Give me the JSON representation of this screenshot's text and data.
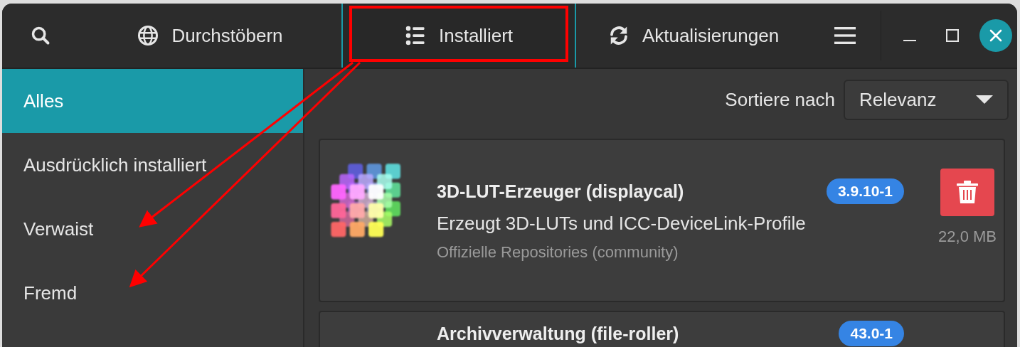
{
  "header": {
    "tabs": [
      {
        "label": "Durchstöbern",
        "selected": false
      },
      {
        "label": "Installiert",
        "selected": true
      },
      {
        "label": "Aktualisierungen",
        "selected": false
      }
    ]
  },
  "sidebar": {
    "items": [
      {
        "label": "Alles",
        "selected": true
      },
      {
        "label": "Ausdrücklich installiert",
        "selected": false
      },
      {
        "label": "Verwaist",
        "selected": false
      },
      {
        "label": "Fremd",
        "selected": false
      }
    ]
  },
  "sort": {
    "label": "Sortiere nach",
    "value": "Relevanz"
  },
  "packages": [
    {
      "name": "3D-LUT-Erzeuger (displaycal)",
      "version": "3.9.10-1",
      "description": "Erzeugt 3D-LUTs und ICC-DeviceLink-Profile",
      "source": "Offizielle Repositories (community)",
      "size": "22,0 MB"
    },
    {
      "name": "Archivverwaltung (file-roller)",
      "version": "43.0-1"
    }
  ]
}
